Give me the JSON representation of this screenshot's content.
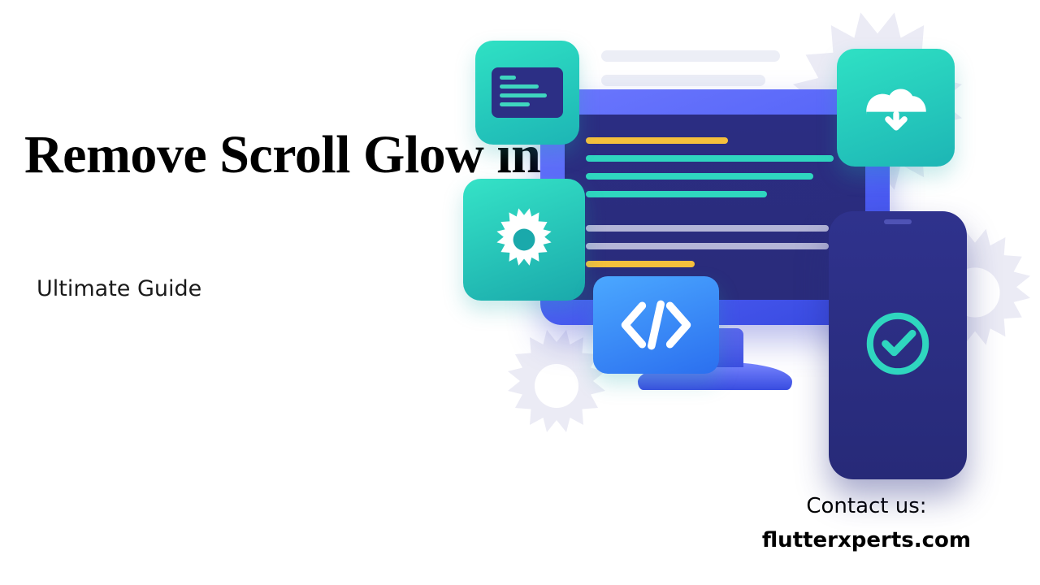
{
  "heading": "Remove Scroll Glow in Flutter",
  "subheading": "Ultimate Guide",
  "contact": {
    "label": "Contact us:",
    "url": "flutterxperts.com"
  },
  "colors": {
    "teal_light": "#2fe1c4",
    "teal_dark": "#1aa9ab",
    "blue_light": "#6b77fd",
    "blue_dark": "#3648de",
    "screen_bg": "#2b2d82",
    "code_yellow": "#f5c03c",
    "code_teal": "#2fd6bf"
  },
  "icons": {
    "top_left": "document-icon",
    "gear": "gear-icon",
    "cloud_download": "cloud-download-icon",
    "code_brackets": "code-brackets-icon",
    "check_circle": "check-circle-icon"
  }
}
